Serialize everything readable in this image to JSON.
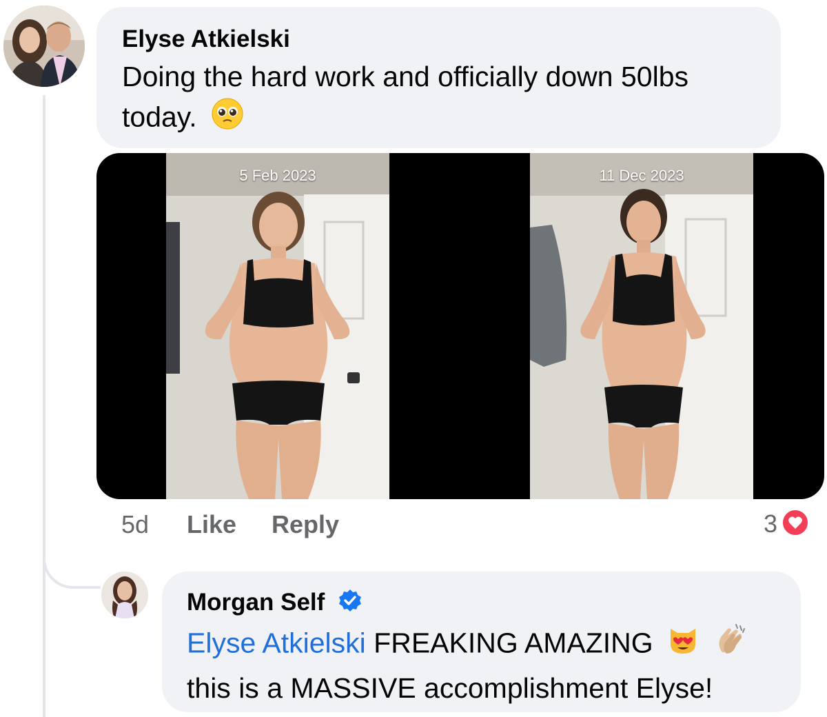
{
  "comment": {
    "author": "Elyse Atkielski",
    "text": "Doing the hard work and officially down 50lbs today.",
    "text_line1": "Doing the hard work and officially down 50lbs",
    "text_line2": "today.",
    "emoji": "pleading-face",
    "photo": {
      "before_date": "5 Feb 2023",
      "after_date": "11 Dec 2023"
    },
    "time": "5d",
    "like_label": "Like",
    "reply_label": "Reply",
    "reaction_count": "3",
    "reaction_type": "love"
  },
  "reply": {
    "author": "Morgan Self",
    "verified": true,
    "mention": "Elyse Atkielski",
    "text_line1": "FREAKING AMAZING",
    "text_line2": "this is a MASSIVE accomplishment Elyse!",
    "emojis": [
      "heart-eyes-cat",
      "clapping-hands"
    ]
  },
  "colors": {
    "bubble": "#f0f2f5",
    "mention": "#216fdb",
    "verified": "#1877f2",
    "love": "#f33e58",
    "meta": "#65676b"
  }
}
